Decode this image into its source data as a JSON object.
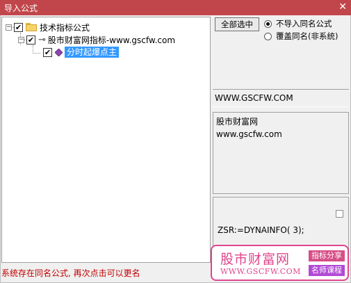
{
  "window": {
    "title": "导入公式",
    "close_glyph": "✕"
  },
  "tree": {
    "root": {
      "label": "技术指标公式",
      "checked": true
    },
    "child": {
      "label": "股市财富网指标-www.gscfw.com",
      "checked": true
    },
    "leaf": {
      "label": "分时起爆点主",
      "checked": true,
      "selected": true
    }
  },
  "controls": {
    "select_all_label": "全部选中",
    "radio_options": [
      {
        "label": "不导入同名公式",
        "selected": true
      },
      {
        "label": "覆盖同名(非系统)",
        "selected": false
      }
    ]
  },
  "details": {
    "url": "WWW.GSCFW.COM",
    "info_line1": "股市财富网",
    "info_line2": "www.gscfw.com",
    "code": "ZSR:=DYNAINFO( 3);"
  },
  "status": {
    "message": "系统存在同名公式, 再次点击可以更名"
  },
  "watermark": {
    "name": "股市财富网",
    "url": "WWW.GSCFW.COM",
    "tag1": "指标分享",
    "tag2": "名师课程"
  },
  "colors": {
    "title_bar": "#c1464b",
    "selection": "#3399ff",
    "status_text": "#c00000",
    "watermark": "#e0458d"
  }
}
